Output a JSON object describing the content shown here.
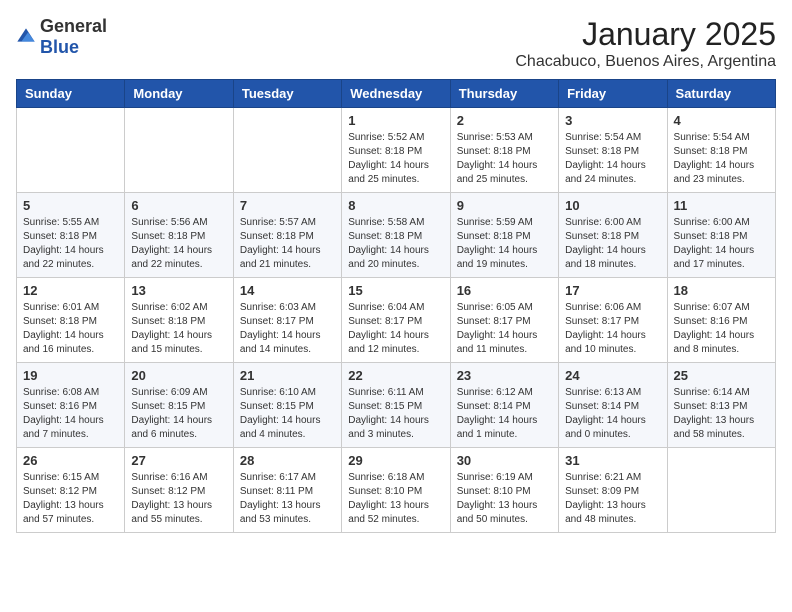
{
  "header": {
    "logo_general": "General",
    "logo_blue": "Blue",
    "month": "January 2025",
    "location": "Chacabuco, Buenos Aires, Argentina"
  },
  "weekdays": [
    "Sunday",
    "Monday",
    "Tuesday",
    "Wednesday",
    "Thursday",
    "Friday",
    "Saturday"
  ],
  "weeks": [
    [
      {
        "day": "",
        "info": ""
      },
      {
        "day": "",
        "info": ""
      },
      {
        "day": "",
        "info": ""
      },
      {
        "day": "1",
        "info": "Sunrise: 5:52 AM\nSunset: 8:18 PM\nDaylight: 14 hours and 25 minutes."
      },
      {
        "day": "2",
        "info": "Sunrise: 5:53 AM\nSunset: 8:18 PM\nDaylight: 14 hours and 25 minutes."
      },
      {
        "day": "3",
        "info": "Sunrise: 5:54 AM\nSunset: 8:18 PM\nDaylight: 14 hours and 24 minutes."
      },
      {
        "day": "4",
        "info": "Sunrise: 5:54 AM\nSunset: 8:18 PM\nDaylight: 14 hours and 23 minutes."
      }
    ],
    [
      {
        "day": "5",
        "info": "Sunrise: 5:55 AM\nSunset: 8:18 PM\nDaylight: 14 hours and 22 minutes."
      },
      {
        "day": "6",
        "info": "Sunrise: 5:56 AM\nSunset: 8:18 PM\nDaylight: 14 hours and 22 minutes."
      },
      {
        "day": "7",
        "info": "Sunrise: 5:57 AM\nSunset: 8:18 PM\nDaylight: 14 hours and 21 minutes."
      },
      {
        "day": "8",
        "info": "Sunrise: 5:58 AM\nSunset: 8:18 PM\nDaylight: 14 hours and 20 minutes."
      },
      {
        "day": "9",
        "info": "Sunrise: 5:59 AM\nSunset: 8:18 PM\nDaylight: 14 hours and 19 minutes."
      },
      {
        "day": "10",
        "info": "Sunrise: 6:00 AM\nSunset: 8:18 PM\nDaylight: 14 hours and 18 minutes."
      },
      {
        "day": "11",
        "info": "Sunrise: 6:00 AM\nSunset: 8:18 PM\nDaylight: 14 hours and 17 minutes."
      }
    ],
    [
      {
        "day": "12",
        "info": "Sunrise: 6:01 AM\nSunset: 8:18 PM\nDaylight: 14 hours and 16 minutes."
      },
      {
        "day": "13",
        "info": "Sunrise: 6:02 AM\nSunset: 8:18 PM\nDaylight: 14 hours and 15 minutes."
      },
      {
        "day": "14",
        "info": "Sunrise: 6:03 AM\nSunset: 8:17 PM\nDaylight: 14 hours and 14 minutes."
      },
      {
        "day": "15",
        "info": "Sunrise: 6:04 AM\nSunset: 8:17 PM\nDaylight: 14 hours and 12 minutes."
      },
      {
        "day": "16",
        "info": "Sunrise: 6:05 AM\nSunset: 8:17 PM\nDaylight: 14 hours and 11 minutes."
      },
      {
        "day": "17",
        "info": "Sunrise: 6:06 AM\nSunset: 8:17 PM\nDaylight: 14 hours and 10 minutes."
      },
      {
        "day": "18",
        "info": "Sunrise: 6:07 AM\nSunset: 8:16 PM\nDaylight: 14 hours and 8 minutes."
      }
    ],
    [
      {
        "day": "19",
        "info": "Sunrise: 6:08 AM\nSunset: 8:16 PM\nDaylight: 14 hours and 7 minutes."
      },
      {
        "day": "20",
        "info": "Sunrise: 6:09 AM\nSunset: 8:15 PM\nDaylight: 14 hours and 6 minutes."
      },
      {
        "day": "21",
        "info": "Sunrise: 6:10 AM\nSunset: 8:15 PM\nDaylight: 14 hours and 4 minutes."
      },
      {
        "day": "22",
        "info": "Sunrise: 6:11 AM\nSunset: 8:15 PM\nDaylight: 14 hours and 3 minutes."
      },
      {
        "day": "23",
        "info": "Sunrise: 6:12 AM\nSunset: 8:14 PM\nDaylight: 14 hours and 1 minute."
      },
      {
        "day": "24",
        "info": "Sunrise: 6:13 AM\nSunset: 8:14 PM\nDaylight: 14 hours and 0 minutes."
      },
      {
        "day": "25",
        "info": "Sunrise: 6:14 AM\nSunset: 8:13 PM\nDaylight: 13 hours and 58 minutes."
      }
    ],
    [
      {
        "day": "26",
        "info": "Sunrise: 6:15 AM\nSunset: 8:12 PM\nDaylight: 13 hours and 57 minutes."
      },
      {
        "day": "27",
        "info": "Sunrise: 6:16 AM\nSunset: 8:12 PM\nDaylight: 13 hours and 55 minutes."
      },
      {
        "day": "28",
        "info": "Sunrise: 6:17 AM\nSunset: 8:11 PM\nDaylight: 13 hours and 53 minutes."
      },
      {
        "day": "29",
        "info": "Sunrise: 6:18 AM\nSunset: 8:10 PM\nDaylight: 13 hours and 52 minutes."
      },
      {
        "day": "30",
        "info": "Sunrise: 6:19 AM\nSunset: 8:10 PM\nDaylight: 13 hours and 50 minutes."
      },
      {
        "day": "31",
        "info": "Sunrise: 6:21 AM\nSunset: 8:09 PM\nDaylight: 13 hours and 48 minutes."
      },
      {
        "day": "",
        "info": ""
      }
    ]
  ]
}
